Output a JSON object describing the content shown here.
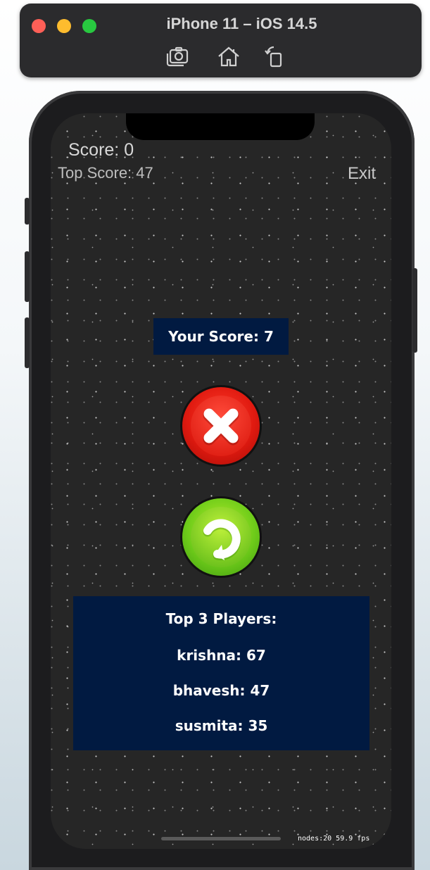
{
  "simulator": {
    "title": "iPhone 11 – iOS 14.5",
    "toolbar": [
      {
        "name": "screenshot-icon"
      },
      {
        "name": "home-icon"
      },
      {
        "name": "rotate-icon"
      }
    ]
  },
  "game": {
    "score_label": "Score: 0",
    "top_score_label": "Top Score: 47",
    "exit_label": "Exit",
    "your_score": "Your Score: 7",
    "close_button_icon": "close-icon",
    "replay_button_icon": "replay-icon",
    "leaderboard": {
      "title": "Top 3 Players:",
      "rows": [
        "krishna: 67",
        "bhavesh: 47",
        "susmita: 35"
      ]
    },
    "debug": "nodes:20  59.9 fps"
  },
  "colors": {
    "panel_bg": "#011a41",
    "close_red": "#e01a10",
    "replay_green": "#6fcc1a",
    "screen_bg": "#262626"
  }
}
